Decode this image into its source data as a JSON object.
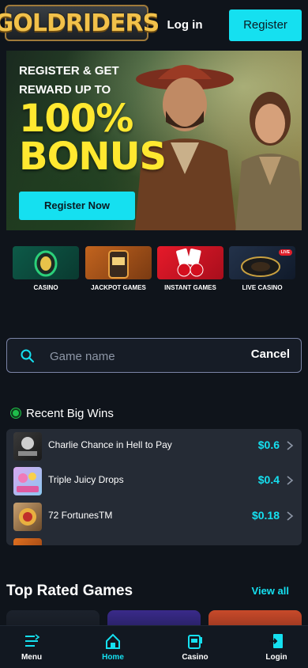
{
  "header": {
    "logo_text": "GOLDRIDERS",
    "login_label": "Log in",
    "register_label": "Register"
  },
  "hero": {
    "subtitle_line1": "REGISTER & GET",
    "subtitle_line2": "REWARD UP TO",
    "headline_line1": "100%",
    "headline_line2": "BONUS",
    "cta_label": "Register Now"
  },
  "categories": [
    {
      "label": "CASINO",
      "icon": "casino-coin-icon"
    },
    {
      "label": "JACKPOT GAMES",
      "icon": "slot-machine-icon"
    },
    {
      "label": "INSTANT GAMES",
      "icon": "cherries-cards-icon"
    },
    {
      "label": "LIVE CASINO",
      "icon": "roulette-icon",
      "badge": "LIVE"
    }
  ],
  "search": {
    "placeholder": "Game name",
    "cancel_label": "Cancel"
  },
  "recent_wins": {
    "title": "Recent Big Wins",
    "items": [
      {
        "name": "Charlie Chance in Hell to Pay",
        "amount": "$0.6"
      },
      {
        "name": "Triple Juicy Drops",
        "amount": "$0.4"
      },
      {
        "name": "72 FortunesTM",
        "amount": "$0.18"
      }
    ]
  },
  "top_rated": {
    "title": "Top Rated Games",
    "view_all_label": "View all"
  },
  "bottom_nav": [
    {
      "label": "Menu",
      "icon": "menu-icon"
    },
    {
      "label": "Home",
      "icon": "home-icon",
      "active": true
    },
    {
      "label": "Casino",
      "icon": "slot-machine-icon"
    },
    {
      "label": "Login",
      "icon": "login-icon"
    }
  ],
  "colors": {
    "accent": "#15e0f0",
    "background": "#0f141b",
    "bonus_yellow": "#ffe830",
    "win_green": "#1fbe4b"
  }
}
